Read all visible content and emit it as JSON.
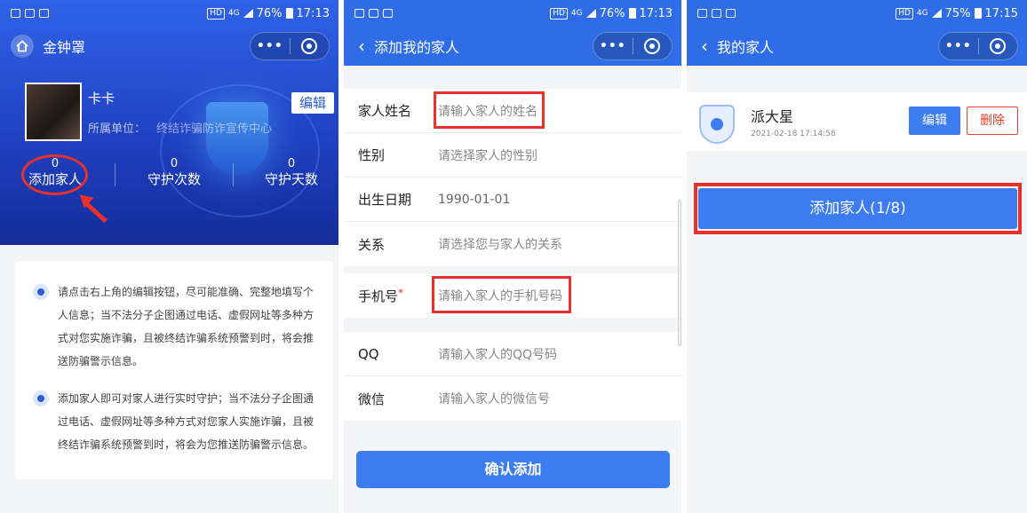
{
  "status": {
    "phone1": {
      "battery": "76%",
      "time": "17:13",
      "network": "4G",
      "hd": "HD"
    },
    "phone2": {
      "battery": "76%",
      "time": "17:13",
      "network": "4G",
      "hd": "HD"
    },
    "phone3": {
      "battery": "75%",
      "time": "17:15",
      "network": "4G",
      "hd": "HD"
    }
  },
  "capsule": {
    "more": "•••"
  },
  "phone1": {
    "title": "金钟罩",
    "user": {
      "name": "卡卡",
      "unit_label": "所属单位：",
      "unit_value": "终结诈骗防诈宣传中心"
    },
    "edit_label": "编辑",
    "stats": [
      {
        "value": "0",
        "label": "添加家人"
      },
      {
        "value": "0",
        "label": "守护次数"
      },
      {
        "value": "0",
        "label": "守护天数"
      }
    ],
    "tips": [
      "请点击右上角的编辑按钮，尽可能准确、完整地填写个人信息；当不法分子企图通过电话、虚假网址等多种方式对您实施诈骗，且被终结诈骗系统预警到时，将会推送防骗警示信息。",
      "添加家人即可对家人进行实时守护；当不法分子企图通过电话、虚假网址等多种方式对您家人实施诈骗，且被终结诈骗系统预警到时，将会为您推送防骗警示信息。"
    ]
  },
  "phone2": {
    "title": "添加我的家人",
    "fields": [
      {
        "label": "家人姓名",
        "placeholder": "请输入家人的姓名"
      },
      {
        "label": "性别",
        "placeholder": "请选择家人的性别"
      },
      {
        "label": "出生日期",
        "value": "1990-01-01"
      },
      {
        "label": "关系",
        "placeholder": "请选择您与家人的关系"
      },
      {
        "label": "手机号",
        "placeholder": "请输入家人的手机号码",
        "required_mark": "*"
      },
      {
        "label": "QQ",
        "placeholder": "请输入家人的QQ号码"
      },
      {
        "label": "微信",
        "placeholder": "请输入家人的微信号"
      }
    ],
    "confirm_label": "确认添加"
  },
  "phone3": {
    "title": "我的家人",
    "family": [
      {
        "name": "派大星",
        "date": "2021-02-18 17:14:58",
        "edit": "编辑",
        "delete": "删除"
      }
    ],
    "add_label": "添加家人(1/8)"
  },
  "colors": {
    "primary": "#2f6ce8",
    "button": "#3c7cf0",
    "highlight": "#e8312a"
  }
}
